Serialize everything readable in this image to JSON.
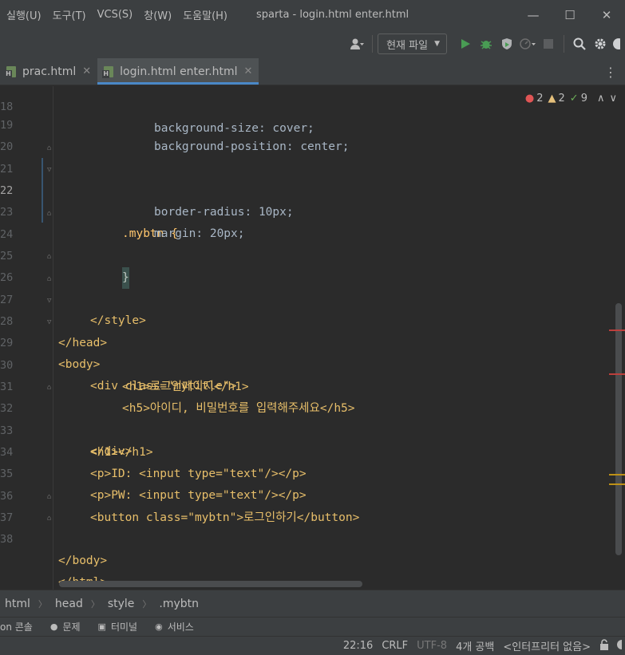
{
  "menu": {
    "items": [
      "실행(U)",
      "도구(T)",
      "VCS(S)",
      "창(W)",
      "도움말(H)"
    ],
    "window_title": "sparta - login.html enter.html"
  },
  "window_controls": {
    "minimize": "—",
    "maximize": "☐",
    "close": "✕"
  },
  "toolbar": {
    "run_config": "현재 파일",
    "icons": [
      "user-icon",
      "run-icon",
      "debug-icon",
      "coverage-icon",
      "profile-icon",
      "stop-icon",
      "search-icon",
      "gear-icon"
    ]
  },
  "tabs": [
    {
      "label": "prac.html",
      "active": false
    },
    {
      "label": "login.html enter.html",
      "active": true
    }
  ],
  "inspections": {
    "errors": "2",
    "warnings": "2",
    "typos": "9"
  },
  "editor": {
    "current_line": "22",
    "lines": [
      {
        "n": "18",
        "text": "background-size: cover;"
      },
      {
        "n": "19",
        "text": "background-position: center;"
      },
      {
        "n": "20",
        "text": ""
      },
      {
        "n": "21",
        "text": "border-radius: 10px;"
      },
      {
        "n": "22",
        "text": ".mybtn {"
      },
      {
        "n": "23",
        "text": "margin: 20px;"
      },
      {
        "n": "24",
        "text": "}"
      },
      {
        "n": "25",
        "text": "}"
      },
      {
        "n": "26",
        "text": "</style>"
      },
      {
        "n": "27",
        "text": "</head>"
      },
      {
        "n": "28",
        "text": "<body>"
      },
      {
        "n": "29",
        "text": "<div class=\"mytitle\">"
      },
      {
        "n": "30",
        "text": "<h1>로그인페이지</h1>"
      },
      {
        "n": "31",
        "text": "<h5>아이디, 비밀번호를 입력해주세요</h5>"
      },
      {
        "n": "32",
        "text": "</div>"
      },
      {
        "n": "33",
        "text": "<h1></h1>"
      },
      {
        "n": "34",
        "text": "<p>ID: <input type=\"text\"/></p>"
      },
      {
        "n": "35",
        "text": "<p>PW: <input type=\"text\"/></p>"
      },
      {
        "n": "36",
        "text": "<button class=\"mybtn\">로그인하기</button>"
      },
      {
        "n": "37",
        "text": "</body>"
      },
      {
        "n": "38",
        "text": "</html>"
      }
    ]
  },
  "breadcrumb": [
    "html",
    "head",
    "style",
    ".mybtn"
  ],
  "tool_windows": [
    {
      "icon": "console-icon",
      "label": "on 콘솔"
    },
    {
      "icon": "problems-icon",
      "label": "문제"
    },
    {
      "icon": "terminal-icon",
      "label": "터미널"
    },
    {
      "icon": "services-icon",
      "label": "서비스"
    }
  ],
  "status": {
    "position": "22:16",
    "line_separator": "CRLF",
    "encoding": "UTF-8",
    "indent": "4개 공백",
    "interpreter": "<인터프리터 없음>"
  }
}
